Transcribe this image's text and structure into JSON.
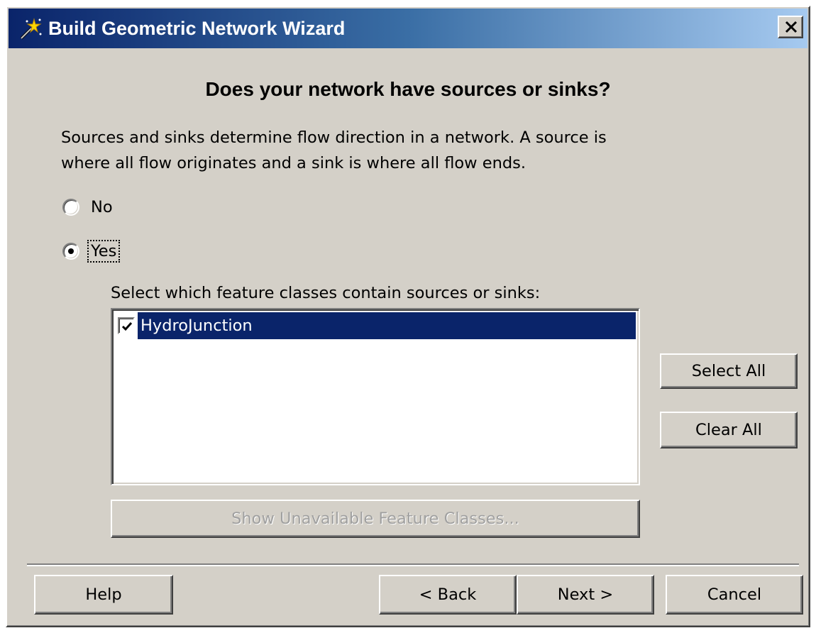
{
  "window": {
    "title": "Build Geometric Network Wizard",
    "icon": "wand-icon",
    "close_glyph": "✕"
  },
  "heading": "Does your network have sources or sinks?",
  "description": {
    "line1": "Sources and sinks determine flow direction in a network. A source is",
    "line2": "where all flow originates and a sink is where all flow ends."
  },
  "options": {
    "no_label": "No",
    "yes_label": "Yes",
    "selected": "Yes"
  },
  "feature_classes": {
    "prompt": "Select which feature classes contain sources or sinks:",
    "items": [
      {
        "label": "HydroJunction",
        "checked": true,
        "selected": true
      }
    ]
  },
  "buttons": {
    "select_all": "Select All",
    "clear_all": "Clear All",
    "show_unavailable": "Show Unavailable Feature Classes...",
    "help": "Help",
    "back": "< Back",
    "next": "Next >",
    "cancel": "Cancel"
  },
  "colors": {
    "face": "#d4d0c8",
    "selection": "#0a246a",
    "titlebar_start": "#0a246a",
    "titlebar_end": "#a6caf0"
  }
}
